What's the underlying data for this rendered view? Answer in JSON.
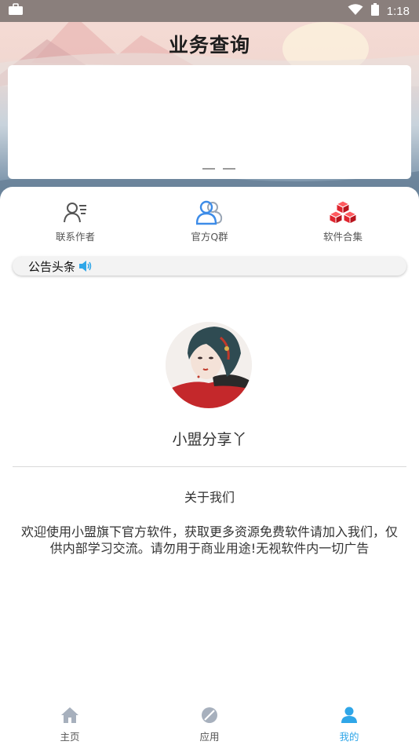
{
  "status_bar": {
    "time": "1:18"
  },
  "header": {
    "title": "业务查询"
  },
  "quick_actions": [
    {
      "label": "联系作者",
      "icon": "contact-author-icon"
    },
    {
      "label": "官方Q群",
      "icon": "qq-group-icon"
    },
    {
      "label": "软件合集",
      "icon": "software-collection-icon"
    }
  ],
  "notice": {
    "label": "公告头条"
  },
  "profile": {
    "nickname": "小盟分享丫",
    "about_title": "关于我们",
    "about_text": "欢迎使用小盟旗下官方软件，获取更多资源免费软件请加入我们，仅供内部学习交流。请勿用于商业用途!无视软件内一切广告"
  },
  "tabbar": [
    {
      "label": "主页",
      "icon": "home-icon"
    },
    {
      "label": "应用",
      "icon": "apps-icon"
    },
    {
      "label": "我的",
      "icon": "profile-icon",
      "active": true
    }
  ],
  "colors": {
    "accent": "#2fa6e8",
    "red": "#e0252f",
    "blue": "#3d8ce8"
  }
}
